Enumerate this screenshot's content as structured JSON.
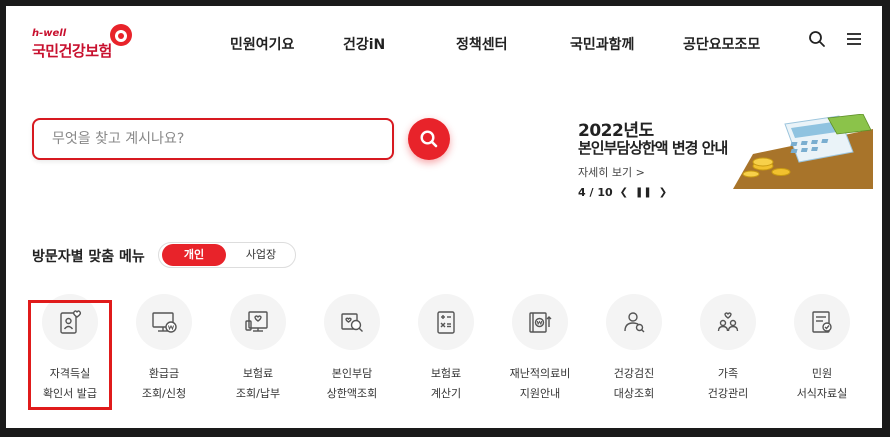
{
  "brand": {
    "small": "h-well",
    "name": "국민건강보험",
    "accent": "#e8232a"
  },
  "gnb": {
    "items": [
      "민원여기요",
      "건강iN",
      "정책센터",
      "국민과함께",
      "공단요모조모"
    ]
  },
  "header_icons": [
    "search-icon",
    "menu-icon"
  ],
  "search": {
    "placeholder": "무엇을 찾고 계시나요?",
    "value": ""
  },
  "notice": {
    "year": "2022년도",
    "title": "본인부담상한액 변경 안내",
    "more": "자세히 보기 >",
    "current": "4",
    "total": "10",
    "page_text": "4 / 10"
  },
  "custom_menu": {
    "title": "방문자별 맞춤 메뉴",
    "tabs": [
      "개인",
      "사업장"
    ],
    "selected_tab": "개인"
  },
  "menu_items": [
    {
      "lines": [
        "자격득실",
        "확인서 발급"
      ],
      "icon": "id-card-heart-icon"
    },
    {
      "lines": [
        "환급금",
        "조회/신청"
      ],
      "icon": "monitor-won-icon"
    },
    {
      "lines": [
        "보험료",
        "조회/납부"
      ],
      "icon": "document-heart-icon"
    },
    {
      "lines": [
        "본인부담",
        "상한액조회"
      ],
      "icon": "magnifier-heart-icon"
    },
    {
      "lines": [
        "보험료",
        "계산기"
      ],
      "icon": "calculator-icon"
    },
    {
      "lines": [
        "재난적의료비",
        "지원안내"
      ],
      "icon": "won-book-icon"
    },
    {
      "lines": [
        "건강검진",
        "대상조회"
      ],
      "icon": "person-search-icon"
    },
    {
      "lines": [
        "가족",
        "건강관리"
      ],
      "icon": "family-heart-icon"
    },
    {
      "lines": [
        "민원",
        "서식자료실"
      ],
      "icon": "form-check-icon"
    }
  ]
}
